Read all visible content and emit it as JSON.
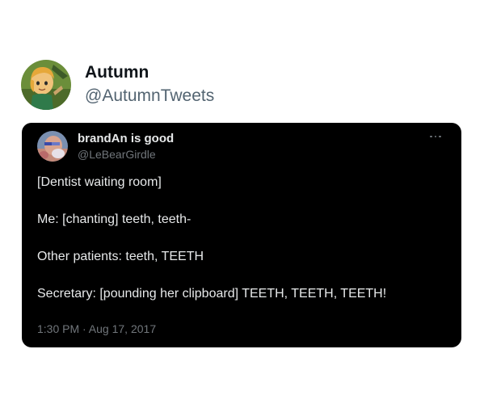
{
  "outer_author": {
    "name": "Autumn",
    "handle": "@AutumnTweets",
    "avatar_icon": "cartoon-character-avatar-icon"
  },
  "quoted_tweet": {
    "author_name": "brandAn is good",
    "author_handle": "@LeBearGirdle",
    "avatar_icon": "blurry-photo-avatar-icon",
    "more_icon": "more-options-icon",
    "lines": [
      "[Dentist waiting room]",
      "Me: [chanting] teeth, teeth-",
      "Other patients: teeth, TEETH",
      "Secretary: [pounding her clipboard] TEETH, TEETH, TEETH!"
    ],
    "timestamp": "1:30 PM · Aug 17, 2017"
  },
  "colors": {
    "card_bg": "#000000",
    "primary_text_dark": "#e7e9ea",
    "secondary_text_dark": "#71767b",
    "primary_text_light": "#0f1419",
    "secondary_text_light": "#536471"
  }
}
